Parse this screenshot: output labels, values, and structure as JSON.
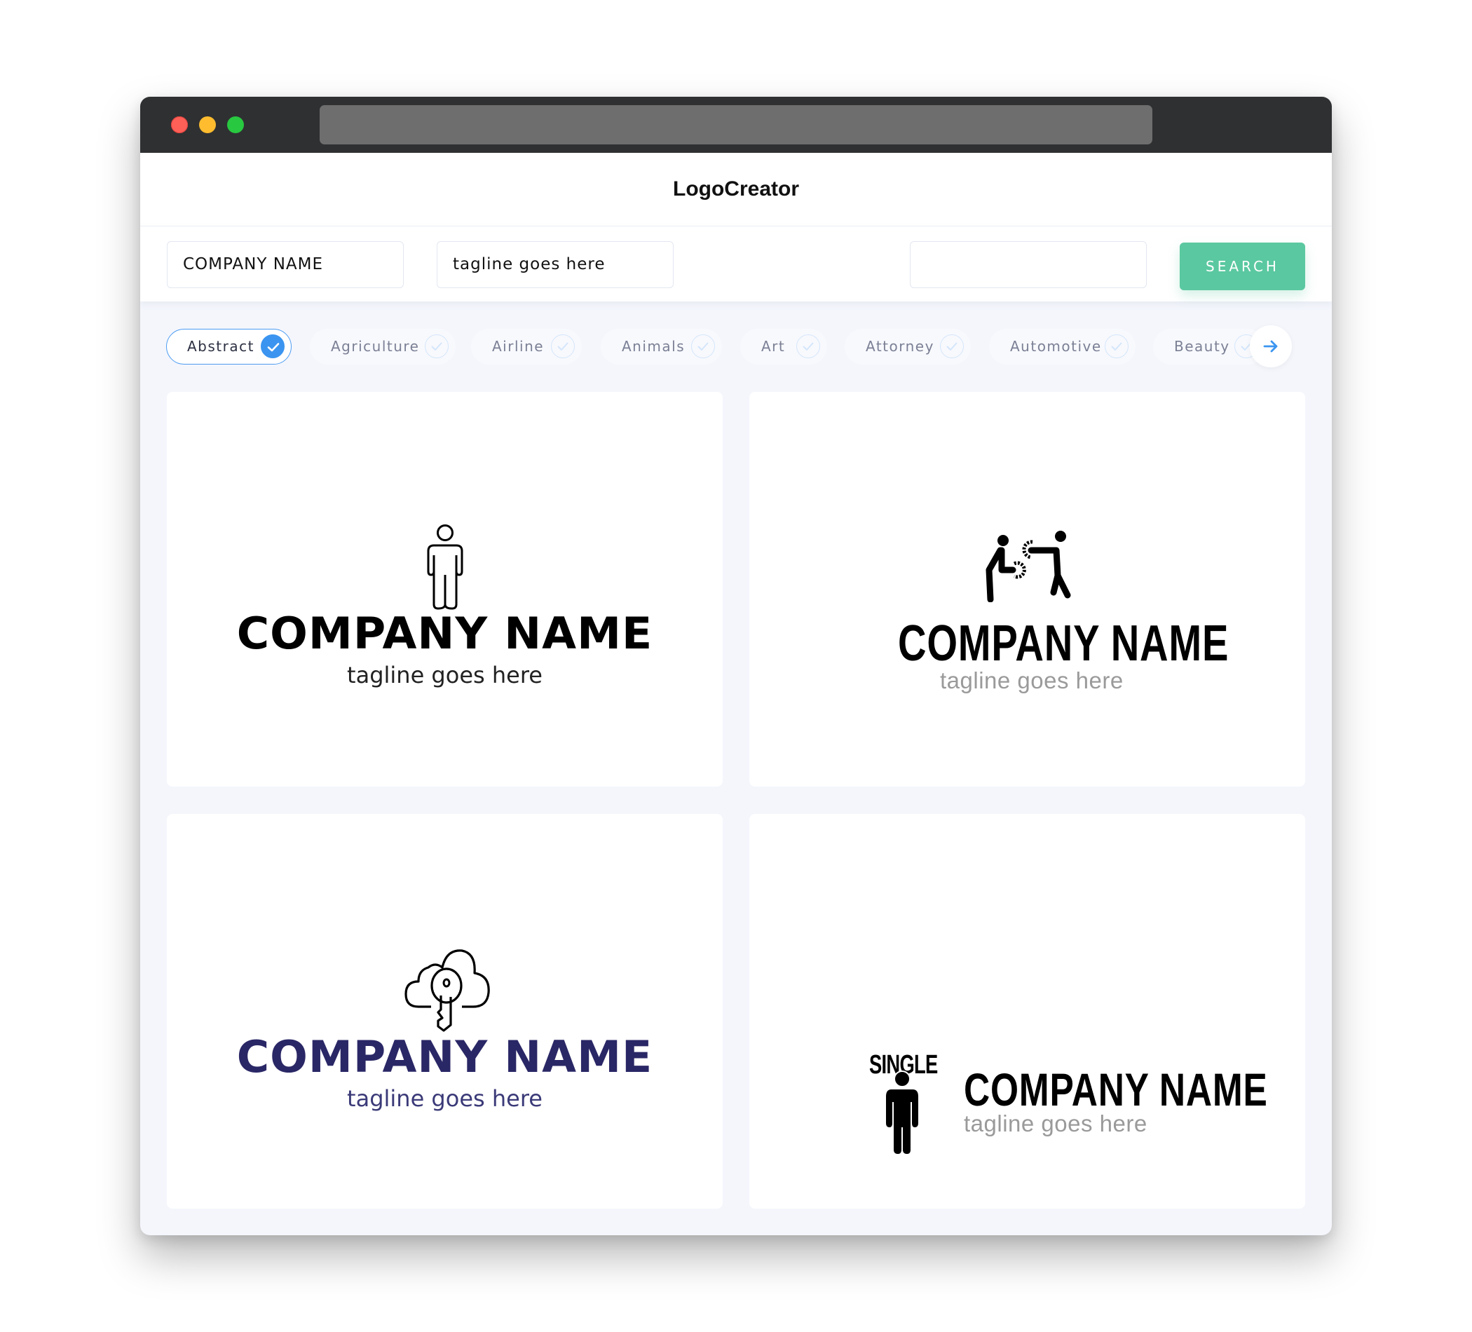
{
  "window": {
    "controls": [
      "close",
      "minimize",
      "maximize"
    ],
    "url": ""
  },
  "nav": {
    "brand": "LogoCreator"
  },
  "inputs": {
    "company_name": "COMPANY NAME",
    "tagline": "tagline goes here",
    "keyword": "",
    "search_label": "SEARCH"
  },
  "categories": [
    {
      "label": "Abstract",
      "selected": true
    },
    {
      "label": "Agriculture",
      "selected": false
    },
    {
      "label": "Airline",
      "selected": false
    },
    {
      "label": "Animals",
      "selected": false
    },
    {
      "label": "Art",
      "selected": false
    },
    {
      "label": "Attorney",
      "selected": false
    },
    {
      "label": "Automotive",
      "selected": false
    },
    {
      "label": "Beauty",
      "selected": false
    }
  ],
  "next_icon": "arrow-right-icon",
  "logos": [
    {
      "icon": "person-outline-icon",
      "name": "COMPANY NAME",
      "tagline": "tagline goes here",
      "name_color": "#000000",
      "tagline_color": "#222222"
    },
    {
      "icon": "people-gears-icon",
      "name": "COMPANY NAME",
      "tagline": "tagline goes here",
      "name_color": "#000000",
      "tagline_color": "#9a9a9a"
    },
    {
      "icon": "cloud-key-icon",
      "name": "COMPANY NAME",
      "tagline": "tagline goes here",
      "name_color": "#2a2766",
      "tagline_color": "#3b3a78"
    },
    {
      "icon": "single-person-icon",
      "icon_text": "SINGLE",
      "name": "COMPANY NAME",
      "tagline": "tagline goes here",
      "name_color": "#000000",
      "tagline_color": "#9a9a9a"
    }
  ],
  "colors": {
    "accent": "#3b95f0",
    "search_button": "#5ac8a0",
    "titlebar": "#2f3032"
  }
}
